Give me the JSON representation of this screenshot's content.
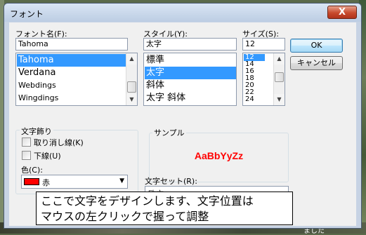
{
  "window": {
    "title": "フォント",
    "close_glyph": "X"
  },
  "font_name": {
    "label": "フォント名(F):",
    "value": "Tahoma",
    "items": [
      {
        "label": "Tahoma",
        "selected": true
      },
      {
        "label": "Verdana",
        "selected": false
      },
      {
        "label": "Webdings",
        "selected": false
      },
      {
        "label": "Wingdings",
        "selected": false
      }
    ]
  },
  "font_style": {
    "label": "スタイル(Y):",
    "value": "太字",
    "items": [
      {
        "label": "標準",
        "selected": false
      },
      {
        "label": "太字",
        "selected": true
      },
      {
        "label": "斜体",
        "selected": false
      },
      {
        "label": "太字 斜体",
        "selected": false
      }
    ]
  },
  "font_size": {
    "label": "サイズ(S):",
    "value": "12",
    "items": [
      {
        "label": "12",
        "selected": true
      },
      {
        "label": "14",
        "selected": false
      },
      {
        "label": "16",
        "selected": false
      },
      {
        "label": "18",
        "selected": false
      },
      {
        "label": "20",
        "selected": false
      },
      {
        "label": "22",
        "selected": false
      },
      {
        "label": "24",
        "selected": false
      }
    ]
  },
  "buttons": {
    "ok": "OK",
    "cancel": "キャンセル"
  },
  "effects": {
    "group_label": "文字飾り",
    "strikeout": "取り消し線(K)",
    "underline": "下線(U)",
    "color_label": "色(C):",
    "color_value": "赤",
    "color_hex": "#ff0000"
  },
  "sample": {
    "group_label": "サンプル",
    "text": "AaBbYyZz"
  },
  "charset": {
    "label": "文字セット(R):",
    "value": "欧文"
  },
  "overlay_note": {
    "line1": "ここで文字をデザインします、文字位置は",
    "line2": "マウスの左クリックで握って調整"
  },
  "background_fragment": "ました",
  "icons": {
    "scroll_up": "▲",
    "scroll_down": "▼",
    "combo_arrow": "▼"
  }
}
